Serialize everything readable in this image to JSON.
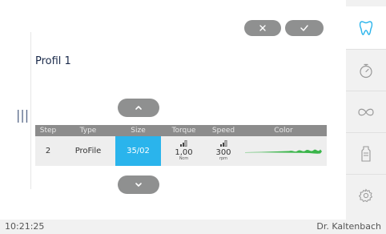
{
  "profile": {
    "title": "Profil 1"
  },
  "table": {
    "headers": [
      "Step",
      "Type",
      "Size",
      "Torque",
      "Speed",
      "Color"
    ],
    "rows": [
      {
        "step": "2",
        "type": "ProFile",
        "size": "35/02",
        "torque": "1,00",
        "torque_unit": "Ncm",
        "speed": "300",
        "speed_unit": "rpm",
        "color": "#3ab54a"
      }
    ]
  },
  "buttons": {
    "cancel_icon": "close-icon",
    "confirm_icon": "check-icon",
    "up_icon": "chevron-up-icon",
    "down_icon": "chevron-down-icon"
  },
  "sidebar": {
    "items": [
      {
        "icon": "tooth-icon",
        "active": true
      },
      {
        "icon": "stopwatch-icon",
        "active": false
      },
      {
        "icon": "infinity-icon",
        "active": false
      },
      {
        "icon": "file-icon",
        "active": false
      },
      {
        "icon": "gear-icon",
        "active": false
      }
    ]
  },
  "status": {
    "time": "10:21:25",
    "user": "Dr. Kaltenbach"
  },
  "colors": {
    "accent": "#2ab4ec",
    "pill": "#8f9090",
    "header": "#8c8c8c",
    "tooth": "#2ab4ec"
  }
}
